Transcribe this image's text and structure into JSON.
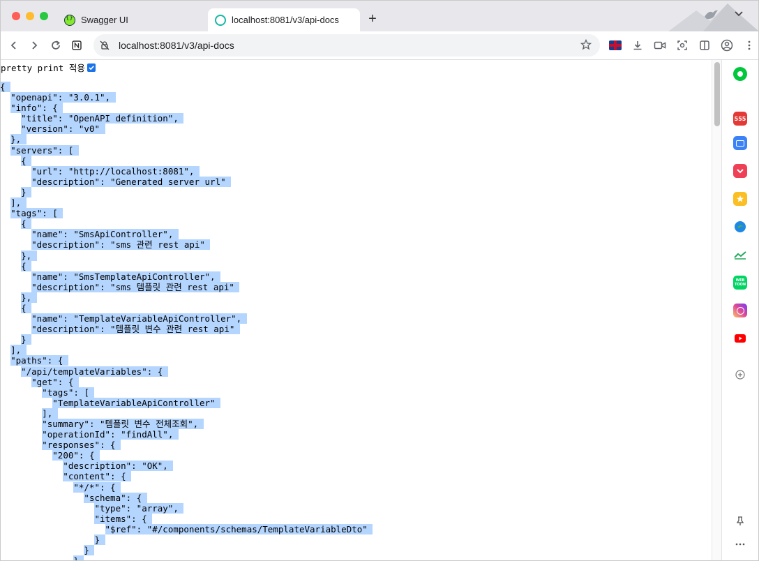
{
  "browser": {
    "tabs": [
      {
        "label": "Swagger UI",
        "icon": "swagger-icon",
        "active": false
      },
      {
        "label": "localhost:8081/v3/api-docs",
        "icon": "globe-icon",
        "active": true
      }
    ],
    "new_tab_label": "+",
    "address": "localhost:8081/v3/api-docs"
  },
  "page": {
    "pretty_print_label": "pretty print 적용",
    "pretty_print_checked": true,
    "json_lines": [
      "{",
      "  \"openapi\": \"3.0.1\",",
      "  \"info\": {",
      "    \"title\": \"OpenAPI definition\",",
      "    \"version\": \"v0\"",
      "  },",
      "  \"servers\": [",
      "    {",
      "      \"url\": \"http://localhost:8081\",",
      "      \"description\": \"Generated server url\"",
      "    }",
      "  ],",
      "  \"tags\": [",
      "    {",
      "      \"name\": \"SmsApiController\",",
      "      \"description\": \"sms 관련 rest api\"",
      "    },",
      "    {",
      "      \"name\": \"SmsTemplateApiController\",",
      "      \"description\": \"sms 템플릿 관련 rest api\"",
      "    },",
      "    {",
      "      \"name\": \"TemplateVariableApiController\",",
      "      \"description\": \"템플릿 변수 관련 rest api\"",
      "    }",
      "  ],",
      "  \"paths\": {",
      "    \"/api/templateVariables\": {",
      "      \"get\": {",
      "        \"tags\": [",
      "          \"TemplateVariableApiController\"",
      "        ],",
      "        \"summary\": \"템플릿 변수 전체조회\",",
      "        \"operationId\": \"findAll\",",
      "        \"responses\": {",
      "          \"200\": {",
      "            \"description\": \"OK\",",
      "            \"content\": {",
      "              \"*/*\": {",
      "                \"schema\": {",
      "                  \"type\": \"array\",",
      "                  \"items\": {",
      "                    \"$ref\": \"#/components/schemas/TemplateVariableDto\"",
      "                  }",
      "                }",
      "              }"
    ]
  },
  "side_panel": {
    "icons": [
      "whale-icon",
      "calendar-555-icon",
      "toolbox-icon",
      "pocket-icon",
      "star-bookmark-icon",
      "edge-icon",
      "chart-icon",
      "webtoon-icon",
      "instagram-icon",
      "youtube-icon",
      "add-icon",
      "pin-icon",
      "more-icon"
    ],
    "calendar_badge": "555",
    "webtoon_badge": "WEB TOON",
    "colors": {
      "whale": "#00c73c",
      "calendar": "#e53935",
      "toolbox": "#3b82f6",
      "pocket": "#ef4056",
      "star": "#fbbf24",
      "instagram": "#d6249f",
      "youtube": "#ff0000",
      "chart": "#1faa59",
      "webtoon": "#00d564"
    }
  },
  "colors": {
    "selection": "#b4d5fe",
    "tab_strip": "#e8e8ec"
  }
}
